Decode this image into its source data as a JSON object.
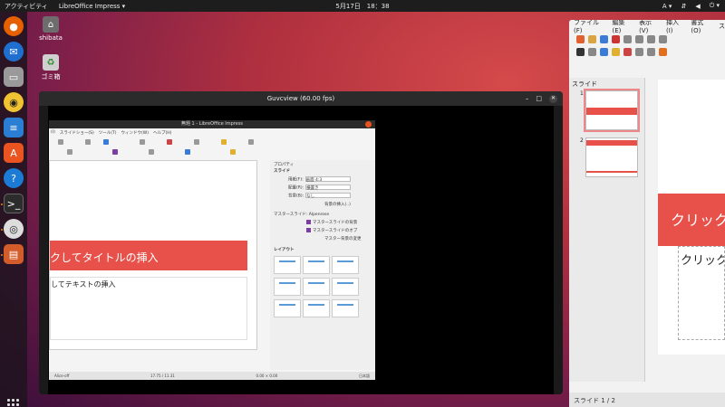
{
  "topbar": {
    "activities": "アクティビティ",
    "app_menu": "LibreOffice Impress ▾",
    "clock": "5月17日　18：38",
    "input_method": "A ▾"
  },
  "desktop": {
    "icons": [
      {
        "label": "shibata",
        "icon": "home-folder-icon"
      },
      {
        "label": "ゴミ箱",
        "icon": "trash-icon"
      }
    ]
  },
  "dock": {
    "items": [
      "firefox-icon",
      "thunderbird-icon",
      "files-icon",
      "rhythmbox-icon",
      "writer-icon",
      "software-icon",
      "help-icon",
      "terminal-icon",
      "webcam-icon",
      "impress-icon"
    ]
  },
  "lo_right": {
    "menu": [
      "ファイル(F)",
      "編集(E)",
      "表示(V)",
      "挿入(I)",
      "書式(O)",
      "ス"
    ],
    "panel_title": "スライド",
    "thumbnails": [
      "1",
      "2"
    ],
    "slide_title_text": "クリック",
    "slide_body_text": "クリックし",
    "status": "スライド 1 / 2"
  },
  "guvcview": {
    "title": "Guvcview  (60.00 fps)",
    "inner": {
      "title": "無題 1 - LibreOffice Impress",
      "menu": [
        "(I)",
        "スライドショー(S)",
        "ツール(T)",
        "ウィンドウ(W)",
        "ヘルプ(H)"
      ],
      "slide_title_text": "クしてタイトルの挿入",
      "slide_body_text": "してテキストの挿入",
      "sidebar": {
        "properties": "プロパティ",
        "slide": "スライド",
        "size_label": "用紙(F):",
        "size_value": "画面 4:3",
        "orient_label": "配置(R):",
        "orient_value": "横置き",
        "bg_label": "背景(B):",
        "bg_value": "なし",
        "insert_image": "背景の挿入(..)",
        "master_label": "マスタースライド:",
        "master_value": "Alpenrose",
        "master_objects": "マスタースライドの背景",
        "master_objects2": "マスタースライドのオブ",
        "master_page": "マスター背景の変更",
        "layout": "レイアウト"
      },
      "status_left": "Alice-off",
      "status_mid": "17.75 / 11.31",
      "status_mid2": "0.00 × 0.00",
      "status_right": "日本語"
    }
  }
}
